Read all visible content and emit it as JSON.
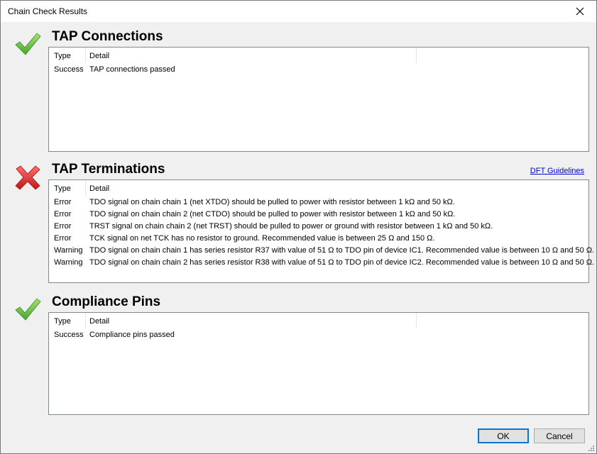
{
  "window": {
    "title": "Chain Check Results"
  },
  "columns": {
    "type": "Type",
    "detail": "Detail"
  },
  "sections": [
    {
      "title": "TAP Connections",
      "status": "success",
      "icon": "green-check-icon",
      "rows": [
        {
          "type": "Success",
          "detail": "TAP connections passed"
        }
      ]
    },
    {
      "title": "TAP Terminations",
      "status": "error",
      "icon": "red-x-icon",
      "link": "DFT Guidelines",
      "rows": [
        {
          "type": "Error",
          "detail": "TDO signal on chain chain 1 (net XTDO) should be pulled to power with resistor between 1 kΩ and 50 kΩ."
        },
        {
          "type": "Error",
          "detail": "TDO signal on chain chain 2 (net CTDO) should be pulled to power with resistor between 1 kΩ and 50 kΩ."
        },
        {
          "type": "Error",
          "detail": "TRST signal on chain chain 2 (net TRST) should be pulled to power or ground with resistor between 1 kΩ and 50 kΩ."
        },
        {
          "type": "Error",
          "detail": "TCK signal on net TCK has no resistor to ground. Recommended value is between 25 Ω and 150 Ω."
        },
        {
          "type": "Warning",
          "detail": "TDO signal on chain chain 1 has series resistor R37 with value of 51 Ω to TDO pin of device IC1. Recommended value is between 10 Ω and 50 Ω."
        },
        {
          "type": "Warning",
          "detail": "TDO signal on chain chain 2 has series resistor R38 with value of 51 Ω to TDO pin of device IC2. Recommended value is between 10 Ω and 50 Ω."
        }
      ]
    },
    {
      "title": "Compliance Pins",
      "status": "success",
      "icon": "green-check-icon",
      "rows": [
        {
          "type": "Success",
          "detail": "Compliance pins passed"
        }
      ]
    }
  ],
  "buttons": {
    "ok": "OK",
    "cancel": "Cancel"
  },
  "colors": {
    "success": "#6cc04a",
    "error": "#e0282b",
    "link": "#0000cc",
    "default_button_border": "#0078d7"
  }
}
